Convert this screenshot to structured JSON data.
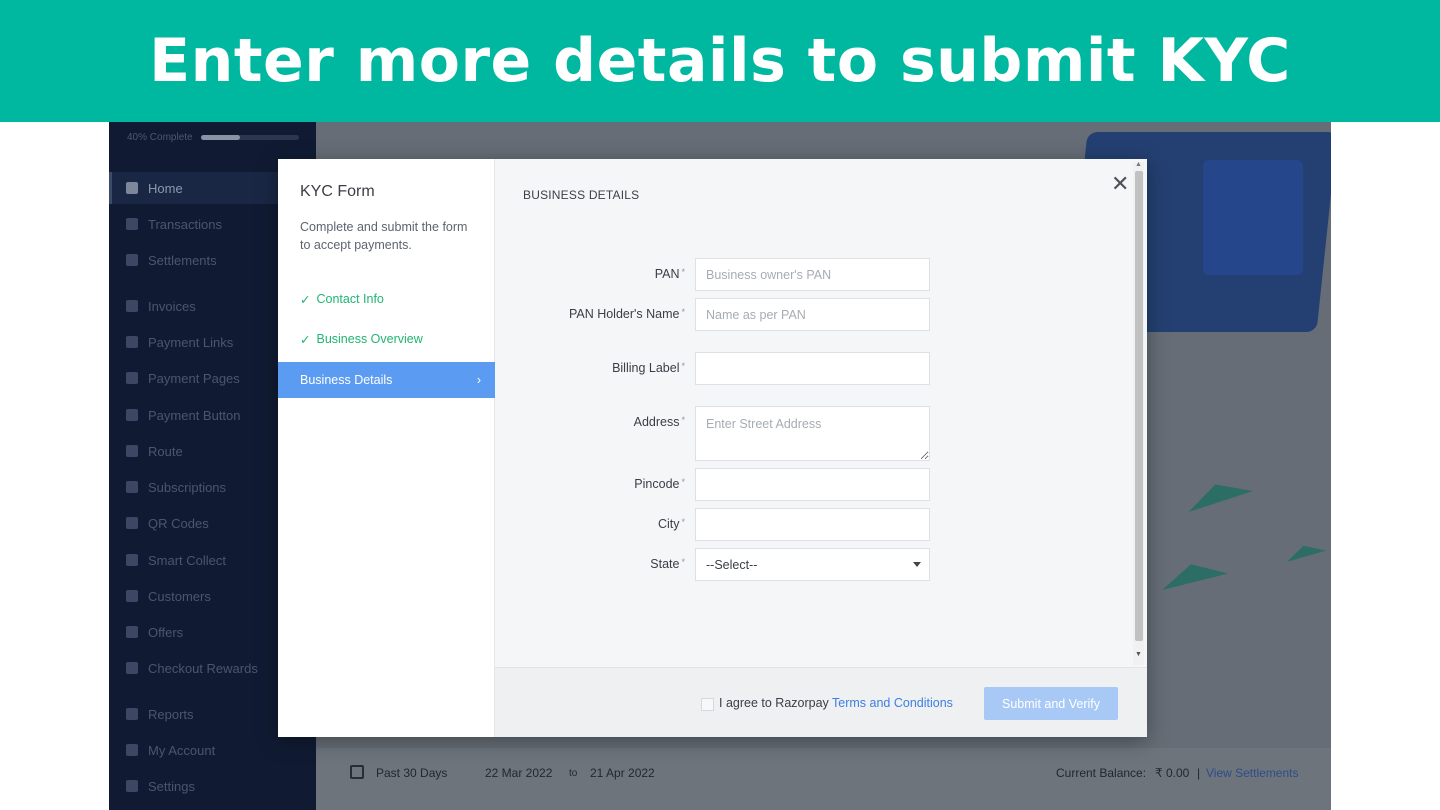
{
  "banner": {
    "title": "Enter more details to submit KYC"
  },
  "colors": {
    "banner_bg": "#00b8a0",
    "sidebar_bg": "#101b33",
    "active_step": "#5b9bf2",
    "done_step": "#21b573",
    "link": "#3d7fe0",
    "submit_disabled": "#a8c9f5"
  },
  "sidebar": {
    "progress_text": "40% Complete",
    "progress_value": 0.4,
    "items": [
      {
        "label": "Home",
        "icon": "home-icon",
        "active": true
      },
      {
        "label": "Transactions",
        "icon": "transactions-icon"
      },
      {
        "label": "Settlements",
        "icon": "settlements-icon"
      },
      {
        "label": "Invoices",
        "icon": "invoice-icon"
      },
      {
        "label": "Payment Links",
        "icon": "link-icon"
      },
      {
        "label": "Payment Pages",
        "icon": "page-icon"
      },
      {
        "label": "Payment Button",
        "icon": "button-icon"
      },
      {
        "label": "Route",
        "icon": "route-icon"
      },
      {
        "label": "Subscriptions",
        "icon": "subscriptions-icon"
      },
      {
        "label": "QR Codes",
        "icon": "qr-icon"
      },
      {
        "label": "Smart Collect",
        "icon": "bank-icon"
      },
      {
        "label": "Customers",
        "icon": "customers-icon"
      },
      {
        "label": "Offers",
        "icon": "tag-icon"
      },
      {
        "label": "Checkout Rewards",
        "icon": "gift-icon"
      },
      {
        "label": "Reports",
        "icon": "reports-icon"
      },
      {
        "label": "My Account",
        "icon": "account-icon"
      },
      {
        "label": "Settings",
        "icon": "gear-icon"
      }
    ]
  },
  "bottom_bar": {
    "range": "Past 30 Days",
    "from": "22 Mar 2022",
    "to_word": "to",
    "to": "21 Apr 2022",
    "balance_label": "Current Balance:",
    "balance_value": "₹ 0.00",
    "separator": "|",
    "settlements_link": "View Settlements"
  },
  "modal": {
    "title": "KYC Form",
    "description": "Complete and submit the form to accept payments.",
    "steps": [
      {
        "label": "Contact Info",
        "status": "done"
      },
      {
        "label": "Business Overview",
        "status": "done"
      },
      {
        "label": "Business Details",
        "status": "active"
      }
    ],
    "check_glyph": "✓",
    "chevron_glyph": "›",
    "close_glyph": "✕",
    "section_title": "BUSINESS DETAILS",
    "fields": {
      "pan": {
        "label": "PAN",
        "placeholder": "Business owner's PAN"
      },
      "pan_holder": {
        "label": "PAN Holder's Name",
        "placeholder": "Name as per PAN"
      },
      "billing_label": {
        "label": "Billing Label",
        "placeholder": ""
      },
      "address": {
        "label": "Address",
        "placeholder": "Enter Street Address"
      },
      "pincode": {
        "label": "Pincode",
        "placeholder": ""
      },
      "city": {
        "label": "City",
        "placeholder": ""
      },
      "state": {
        "label": "State",
        "value": "--Select--"
      }
    },
    "required_mark": "*",
    "agree_prefix": "I agree to Razorpay ",
    "terms_link": "Terms and Conditions",
    "submit": "Submit and Verify"
  }
}
